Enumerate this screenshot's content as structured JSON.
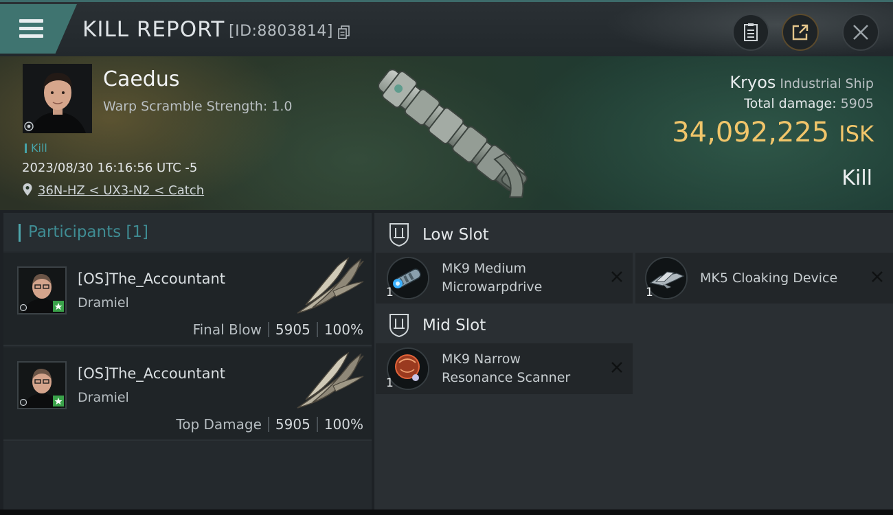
{
  "header": {
    "title": "KILL REPORT",
    "kill_id": "[ID:8803814]"
  },
  "victim": {
    "pilot_name": "Caedus",
    "warp_scramble": "Warp Scramble Strength: 1.0",
    "kill_tag": "Kill",
    "datetime": "2023/08/30 16:16:56 UTC -5",
    "location": "36N-HZ < UX3-N2 < Catch",
    "ship_name": "Kryos",
    "ship_class": "Industrial Ship",
    "total_damage_label": "Total damage:",
    "total_damage": "5905",
    "isk_value": "34,092,225",
    "isk_unit": "ISK",
    "result": "Kill"
  },
  "participants": {
    "label": "Participants [1]",
    "rows": [
      {
        "name": "[OS]The_Accountant",
        "ship": "Dramiel",
        "role": "Final Blow",
        "damage": "5905",
        "percent": "100%"
      },
      {
        "name": "[OS]The_Accountant",
        "ship": "Dramiel",
        "role": "Top Damage",
        "damage": "5905",
        "percent": "100%"
      }
    ]
  },
  "fittings": {
    "low_slot_label": "Low Slot",
    "mid_slot_label": "Mid Slot",
    "low_slot": [
      {
        "line1": "MK9 Medium",
        "line2": "Microwarpdrive",
        "qty": "1"
      },
      {
        "line1": "MK5 Cloaking Device",
        "line2": "",
        "qty": "1"
      }
    ],
    "mid_slot": [
      {
        "line1": "MK9 Narrow",
        "line2": "Resonance Scanner",
        "qty": "1"
      }
    ]
  },
  "colors": {
    "accent_teal": "#3f7470",
    "isk_gold": "#f1c56a",
    "participants_label": "#3f8c93"
  }
}
